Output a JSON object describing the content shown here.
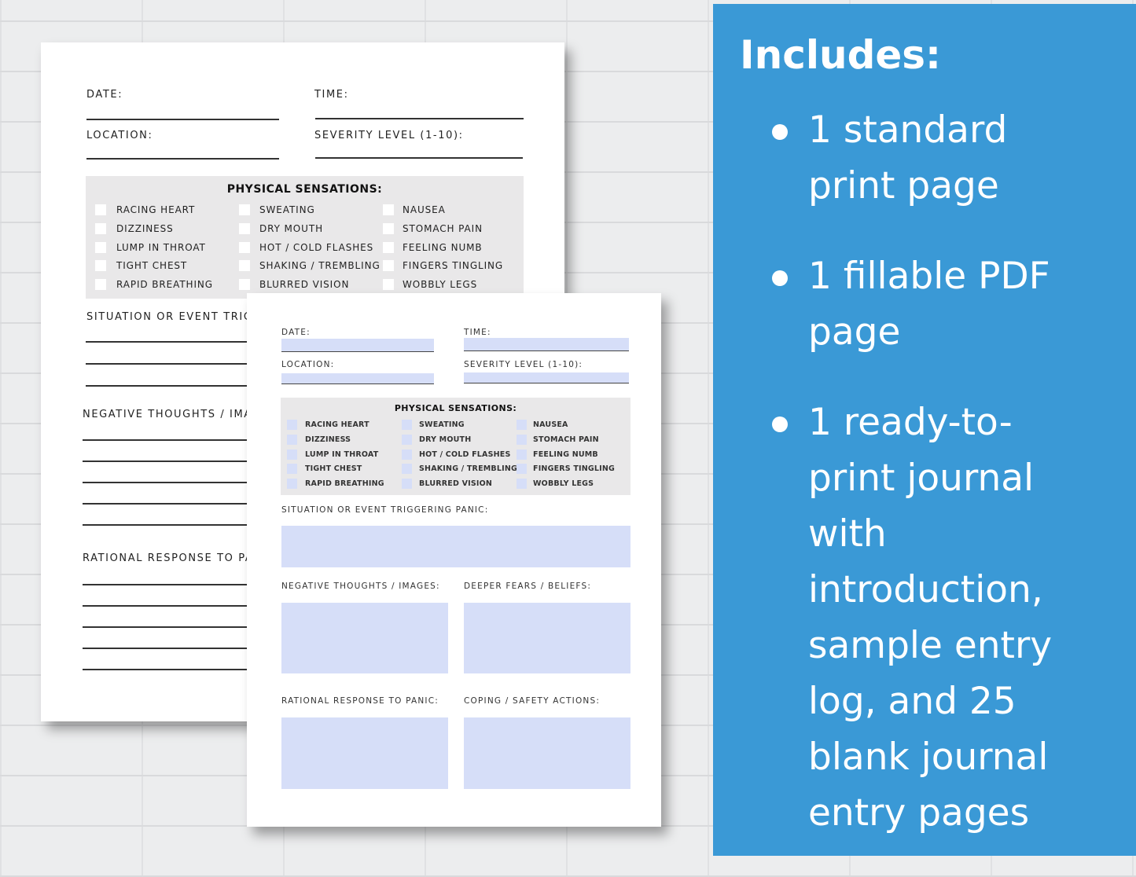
{
  "back_page": {
    "date_label": "DATE:",
    "time_label": "TIME:",
    "location_label": "LOCATION:",
    "severity_label": "SEVERITY LEVEL (1-10):",
    "sensations_title": "PHYSICAL SENSATIONS:",
    "sensations": [
      [
        "RACING HEART",
        "DIZZINESS",
        "LUMP IN THROAT",
        "TIGHT CHEST",
        "RAPID BREATHING"
      ],
      [
        "SWEATING",
        "DRY MOUTH",
        "HOT / COLD FLASHES",
        "SHAKING / TREMBLING",
        "BLURRED VISION"
      ],
      [
        "NAUSEA",
        "STOMACH PAIN",
        "FEELING NUMB",
        "FINGERS TINGLING",
        "WOBBLY LEGS"
      ]
    ],
    "situation_label": "SITUATION OR EVENT TRIG",
    "negative_label": "NEGATIVE THOUGHTS / IMA",
    "rational_label": "RATIONAL RESPONSE TO PA"
  },
  "front_page": {
    "date_label": "DATE:",
    "time_label": "TIME:",
    "location_label": "LOCATION:",
    "severity_label": "SEVERITY LEVEL (1-10):",
    "sensations_title": "PHYSICAL SENSATIONS:",
    "sensations": [
      [
        "RACING HEART",
        "DIZZINESS",
        "LUMP IN THROAT",
        "TIGHT CHEST",
        "RAPID BREATHING"
      ],
      [
        "SWEATING",
        "DRY MOUTH",
        "HOT / COLD FLASHES",
        "SHAKING / TREMBLING",
        "BLURRED VISION"
      ],
      [
        "NAUSEA",
        "STOMACH PAIN",
        "FEELING NUMB",
        "FINGERS TINGLING",
        "WOBBLY LEGS"
      ]
    ],
    "situation_label": "SITUATION OR EVENT TRIGGERING PANIC:",
    "negative_label": "NEGATIVE THOUGHTS / IMAGES:",
    "deeper_label": "DEEPER FEARS / BELIEFS:",
    "rational_label": "RATIONAL RESPONSE TO PANIC:",
    "coping_label": "COPING / SAFETY ACTIONS:"
  },
  "panel": {
    "heading": "Includes:",
    "items": [
      [
        "1 standard",
        "print page"
      ],
      [
        "1 fillable PDF",
        "page"
      ],
      [
        "1 ready-to-",
        "print journal",
        "with",
        "introduction,",
        "sample entry",
        "log, and 25",
        "blank journal",
        "entry pages"
      ]
    ]
  },
  "colors": {
    "panel": "#3a99d6",
    "field_fill": "#d6def8",
    "sensation_box": "#e9e8e9"
  }
}
